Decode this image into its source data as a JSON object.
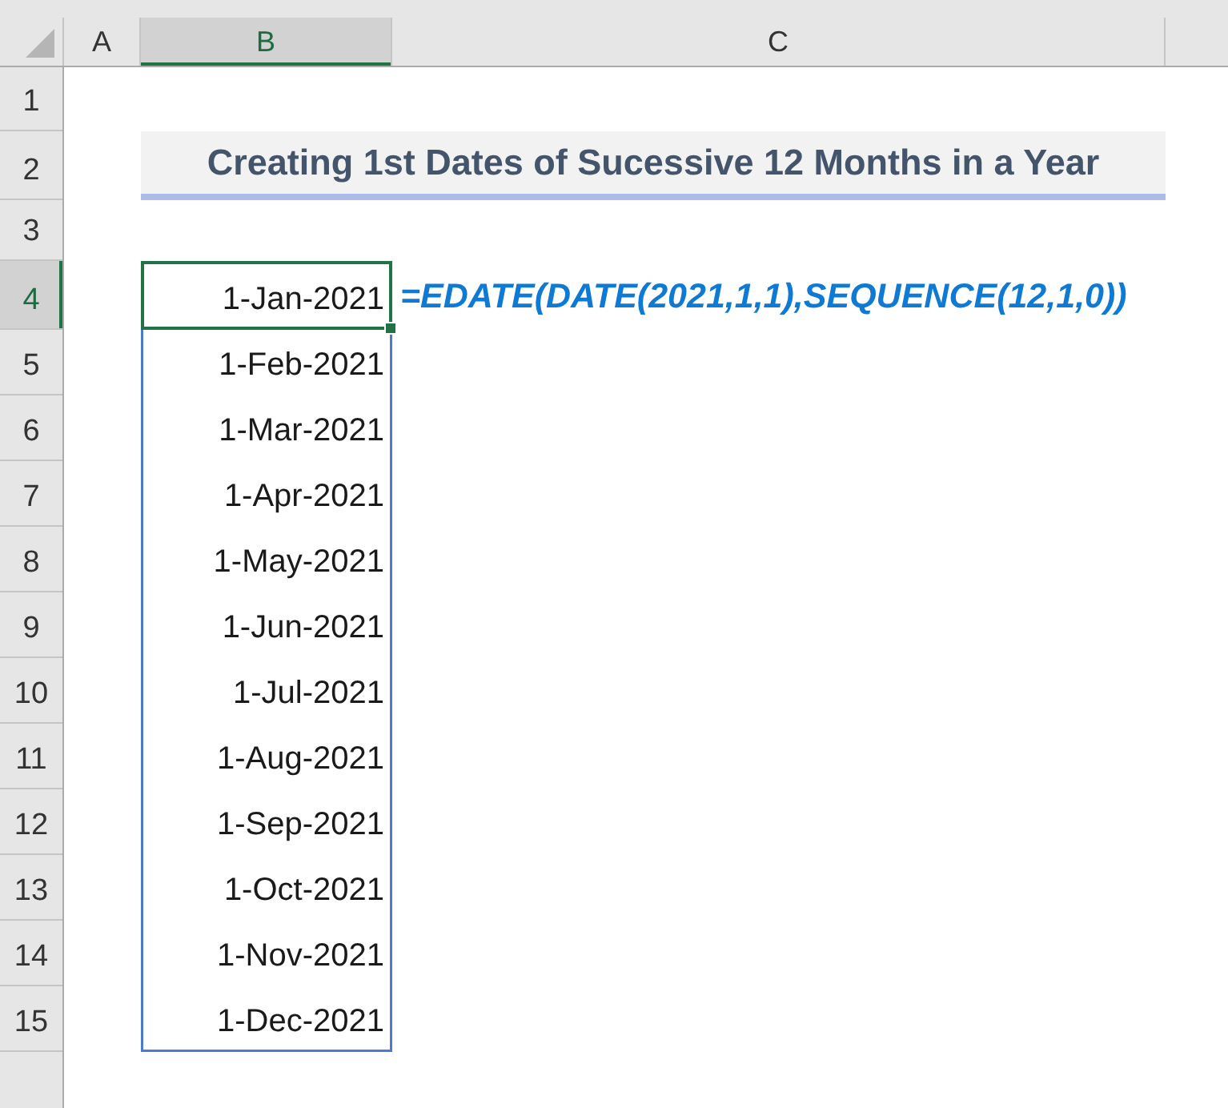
{
  "column_headers": [
    {
      "label": "A",
      "selected": false
    },
    {
      "label": "B",
      "selected": true
    },
    {
      "label": "C",
      "selected": false
    }
  ],
  "row_headers": [
    {
      "label": "1",
      "selected": false
    },
    {
      "label": "2",
      "selected": false
    },
    {
      "label": "3",
      "selected": false
    },
    {
      "label": "4",
      "selected": true
    },
    {
      "label": "5",
      "selected": false
    },
    {
      "label": "6",
      "selected": false
    },
    {
      "label": "7",
      "selected": false
    },
    {
      "label": "8",
      "selected": false
    },
    {
      "label": "9",
      "selected": false
    },
    {
      "label": "10",
      "selected": false
    },
    {
      "label": "11",
      "selected": false
    },
    {
      "label": "12",
      "selected": false
    },
    {
      "label": "13",
      "selected": false
    },
    {
      "label": "14",
      "selected": false
    },
    {
      "label": "15",
      "selected": false
    }
  ],
  "title": "Creating 1st Dates of Sucessive 12 Months in a Year",
  "spill_range": [
    {
      "value": "1-Jan-2021",
      "selected": true
    },
    {
      "value": "1-Feb-2021",
      "selected": false
    },
    {
      "value": "1-Mar-2021",
      "selected": false
    },
    {
      "value": "1-Apr-2021",
      "selected": false
    },
    {
      "value": "1-May-2021",
      "selected": false
    },
    {
      "value": "1-Jun-2021",
      "selected": false
    },
    {
      "value": "1-Jul-2021",
      "selected": false
    },
    {
      "value": "1-Aug-2021",
      "selected": false
    },
    {
      "value": "1-Sep-2021",
      "selected": false
    },
    {
      "value": "1-Oct-2021",
      "selected": false
    },
    {
      "value": "1-Nov-2021",
      "selected": false
    },
    {
      "value": "1-Dec-2021",
      "selected": false
    }
  ],
  "formula": "=EDATE(DATE(2021,1,1),SEQUENCE(12,1,0))"
}
